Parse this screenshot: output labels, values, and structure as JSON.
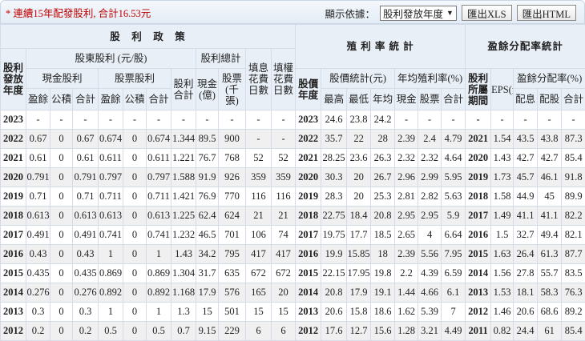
{
  "note": "* 連續15年配發股利, 合計16.53元",
  "toolbar": {
    "display_label": "顯示依據：",
    "select_value": "股利發放年度",
    "export_xls": "匯出XLS",
    "export_html": "匯出HTML"
  },
  "headers": {
    "policy": "股　利　政　策",
    "yield_stats": "殖 利 率 統 計",
    "payout_stats": "盈餘分配率統計",
    "year": "股利發放年度",
    "shareholder_div": "股東股利 (元/股)",
    "div_total": "股利總計",
    "fill_div": "填息花費日數",
    "fill_right": "填權花費日數",
    "cash_div": "現金股利",
    "stock_div": "股票股利",
    "div_sum": "股利合計",
    "cash_total": "現金(億)",
    "stock_total": "股票(千張)",
    "earn": "盈餘",
    "reserve": "公積",
    "sum": "合計",
    "price_year": "股價年度",
    "price_stats": "股價統計(元)",
    "avg_yield": "年均殖利率(%)",
    "high": "最高",
    "low": "最低",
    "avg": "年均",
    "y_cash": "現金",
    "y_stock": "股票",
    "y_sum": "合計",
    "period": "股利所屬期間",
    "eps": "EPS(元)",
    "payout_rate": "盈餘分配率(%)",
    "p_cash": "配息",
    "p_stock": "配股",
    "p_sum": "合計"
  },
  "rows": [
    [
      "2023",
      "-",
      "-",
      "-",
      "-",
      "-",
      "-",
      "-",
      "-",
      "-",
      "-",
      "-",
      "2023",
      "24.6",
      "23.8",
      "24.2",
      "-",
      "-",
      "-",
      "-",
      "-",
      "-",
      "-",
      "-"
    ],
    [
      "2022",
      "0.67",
      "0",
      "0.67",
      "0.674",
      "0",
      "0.674",
      "1.344",
      "89.5",
      "900",
      "-",
      "-",
      "2022",
      "35.7",
      "22",
      "28",
      "2.39",
      "2.4",
      "4.79",
      "2021",
      "1.54",
      "43.5",
      "43.8",
      "87.3"
    ],
    [
      "2021",
      "0.61",
      "0",
      "0.61",
      "0.611",
      "0",
      "0.611",
      "1.221",
      "76.7",
      "768",
      "52",
      "52",
      "2021",
      "28.25",
      "23.6",
      "26.3",
      "2.32",
      "2.32",
      "4.64",
      "2020",
      "1.43",
      "42.7",
      "42.7",
      "85.4"
    ],
    [
      "2020",
      "0.791",
      "0",
      "0.791",
      "0.797",
      "0",
      "0.797",
      "1.588",
      "91.9",
      "926",
      "359",
      "359",
      "2020",
      "30.3",
      "20",
      "26.7",
      "2.96",
      "2.99",
      "5.95",
      "2019",
      "1.73",
      "45.7",
      "46.1",
      "91.8"
    ],
    [
      "2019",
      "0.71",
      "0",
      "0.71",
      "0.711",
      "0",
      "0.711",
      "1.421",
      "76.9",
      "770",
      "116",
      "116",
      "2019",
      "28.3",
      "20",
      "25.3",
      "2.81",
      "2.82",
      "5.63",
      "2018",
      "1.58",
      "44.9",
      "45",
      "89.9"
    ],
    [
      "2018",
      "0.613",
      "0",
      "0.613",
      "0.613",
      "0",
      "0.613",
      "1.225",
      "62.4",
      "624",
      "21",
      "21",
      "2018",
      "22.75",
      "18.4",
      "20.8",
      "2.95",
      "2.95",
      "5.9",
      "2017",
      "1.49",
      "41.1",
      "41.1",
      "82.2"
    ],
    [
      "2017",
      "0.491",
      "0",
      "0.491",
      "0.741",
      "0",
      "0.741",
      "1.232",
      "46.5",
      "701",
      "106",
      "74",
      "2017",
      "19.75",
      "17.7",
      "18.5",
      "2.65",
      "4",
      "6.64",
      "2016",
      "1.5",
      "32.7",
      "49.4",
      "82.1"
    ],
    [
      "2016",
      "0.43",
      "0",
      "0.43",
      "1",
      "0",
      "1",
      "1.43",
      "34.2",
      "795",
      "417",
      "417",
      "2016",
      "19.9",
      "15.85",
      "18",
      "2.39",
      "5.56",
      "7.95",
      "2015",
      "1.63",
      "26.4",
      "61.3",
      "87.7"
    ],
    [
      "2015",
      "0.435",
      "0",
      "0.435",
      "0.869",
      "0",
      "0.869",
      "1.304",
      "31.7",
      "635",
      "672",
      "672",
      "2015",
      "22.15",
      "17.95",
      "19.8",
      "2.2",
      "4.39",
      "6.59",
      "2014",
      "1.56",
      "27.8",
      "55.7",
      "83.5"
    ],
    [
      "2014",
      "0.276",
      "0",
      "0.276",
      "0.892",
      "0",
      "0.892",
      "1.168",
      "17.9",
      "576",
      "165",
      "20",
      "2014",
      "20.8",
      "17.9",
      "19.1",
      "1.44",
      "4.66",
      "6.1",
      "2013",
      "1.53",
      "18.1",
      "58.3",
      "76.3"
    ],
    [
      "2013",
      "0.3",
      "0",
      "0.3",
      "1",
      "0",
      "1",
      "1.3",
      "15",
      "501",
      "15",
      "15",
      "2013",
      "20.6",
      "15.8",
      "18.6",
      "1.62",
      "5.39",
      "7",
      "2012",
      "1.46",
      "20.6",
      "68.6",
      "89.2"
    ],
    [
      "2012",
      "0.2",
      "0",
      "0.2",
      "0.5",
      "0",
      "0.5",
      "0.7",
      "9.15",
      "229",
      "6",
      "6",
      "2012",
      "17.6",
      "12.7",
      "15.6",
      "1.28",
      "3.21",
      "4.49",
      "2011",
      "0.82",
      "24.4",
      "61",
      "85.4"
    ]
  ]
}
